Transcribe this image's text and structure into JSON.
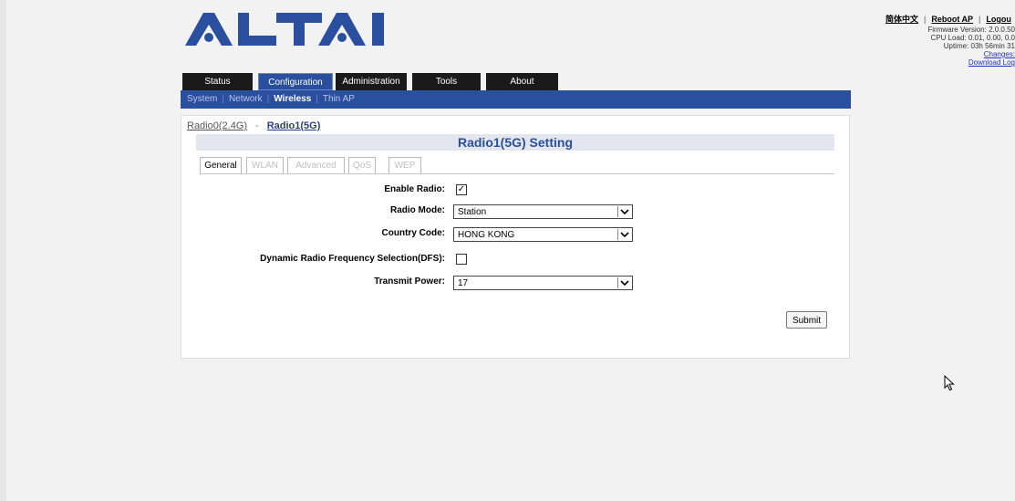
{
  "brand": {
    "logo_text": "ALTAI",
    "color": "#2a4f9f"
  },
  "top_links": {
    "language": "简体中文",
    "reboot": "Reboot AP",
    "logout": "Logou",
    "separator": "|"
  },
  "system_info": {
    "firmware": "Firmware Version: 2.0.0.50",
    "cpu": "CPU Load: 0.01, 0.00, 0.0",
    "uptime": "Uptime: 03h 56min 31",
    "changes": "Changes:",
    "download_log": "Download Log"
  },
  "main_tabs": [
    "Status",
    "Configuration",
    "Administration",
    "Tools",
    "About"
  ],
  "active_main_tab": "Configuration",
  "sub_nav": [
    "System",
    "Network",
    "Wireless",
    "Thin AP"
  ],
  "active_sub_nav": "Wireless",
  "radio_links": {
    "radio0": "Radio0(2.4G)",
    "dash": "-",
    "radio1": "Radio1(5G)"
  },
  "setting_title": "Radio1(5G) Setting",
  "sub_tabs": [
    "General",
    "WLAN",
    "Advanced",
    "QoS",
    "WEP"
  ],
  "active_sub_tab": "General",
  "form": {
    "enable_radio": {
      "label": "Enable Radio:",
      "checked": true,
      "mark": "✓"
    },
    "radio_mode": {
      "label": "Radio Mode:",
      "value": "Station"
    },
    "country_code": {
      "label": "Country Code:",
      "value": "HONG KONG"
    },
    "dfs": {
      "label": "Dynamic Radio Frequency Selection(DFS):",
      "checked": false,
      "mark": ""
    },
    "transmit_power": {
      "label": "Transmit Power:",
      "value": "17"
    }
  },
  "submit_label": "Submit",
  "icons": {
    "dropdown": "chevron-down-icon",
    "cursor": "mouse-pointer-icon"
  }
}
